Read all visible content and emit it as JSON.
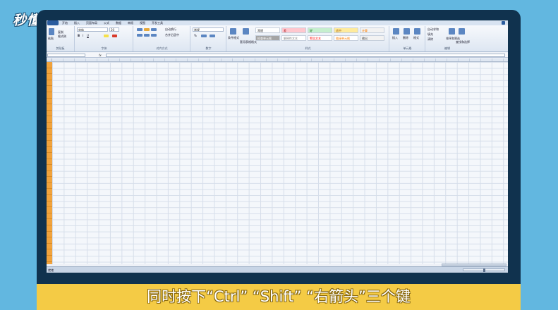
{
  "watermark": {
    "logo_text": "秒懂视频"
  },
  "excel": {
    "tabs": [
      "开始",
      "插入",
      "页面布局",
      "公式",
      "数据",
      "审阅",
      "视图",
      "开发工具"
    ],
    "ribbon": {
      "clipboard": {
        "label": "剪贴板",
        "paste": "粘贴",
        "copy": "复制",
        "format_painter": "格式刷"
      },
      "font": {
        "label": "字体",
        "font_name": "宋体",
        "font_size": "20",
        "bold": "B",
        "italic": "I",
        "underline": "U"
      },
      "alignment": {
        "label": "对齐方式",
        "wrap": "自动换行",
        "merge": "合并后居中"
      },
      "number": {
        "label": "数字",
        "format": "常规",
        "percent": "%"
      },
      "styles": {
        "label": "样式",
        "conditional_formatting": "条件格式",
        "format_as_table": "套用表格格式",
        "cell_styles": [
          {
            "text": "常规",
            "bg": "#ffffff",
            "fg": "#222222"
          },
          {
            "text": "差",
            "bg": "#ffc7ce",
            "fg": "#9c0006"
          },
          {
            "text": "好",
            "bg": "#c6efce",
            "fg": "#006100"
          },
          {
            "text": "适中",
            "bg": "#ffeb9c",
            "fg": "#9c5700"
          },
          {
            "text": "计算",
            "bg": "#f2f2f2",
            "fg": "#fa7d00"
          },
          {
            "text": "检查单元格",
            "bg": "#a5a5a5",
            "fg": "#ffffff"
          },
          {
            "text": "解释性文本",
            "bg": "#ffffff",
            "fg": "#7f7f7f"
          },
          {
            "text": "警告文本",
            "bg": "#ffffff",
            "fg": "#ff0000"
          },
          {
            "text": "链接单元格",
            "bg": "#ffffff",
            "fg": "#fa7d00"
          },
          {
            "text": "输出",
            "bg": "#f2f2f2",
            "fg": "#3f3f3f"
          }
        ]
      },
      "cells": {
        "label": "单元格",
        "insert": "插入",
        "delete": "删除",
        "format": "格式"
      },
      "editing": {
        "label": "编辑",
        "autosum": "自动求和",
        "fill": "填充",
        "clear": "清除",
        "sort_filter": "排序和筛选",
        "find_select": "查找和选择"
      }
    },
    "formula_bar": {
      "fx": "fx"
    },
    "status": {
      "ready": "就绪"
    }
  },
  "caption": {
    "text": "同时按下“Ctrl” “Shift” “右箭头”三个键"
  }
}
